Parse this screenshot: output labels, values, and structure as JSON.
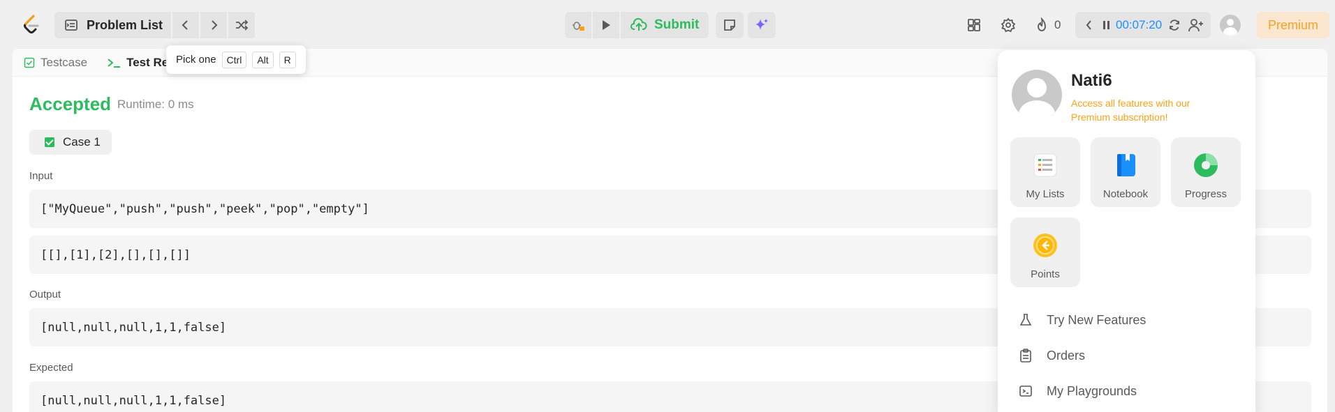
{
  "topbar": {
    "problem_list": "Problem List",
    "submit": "Submit",
    "streak": "0",
    "timer": "00:07:20",
    "premium": "Premium"
  },
  "tabs": [
    {
      "label": "Testcase"
    },
    {
      "label": "Test Resu"
    }
  ],
  "tooltip": {
    "label": "Pick one",
    "keys": [
      "Ctrl",
      "Alt",
      "R"
    ]
  },
  "result": {
    "status": "Accepted",
    "runtime": "Runtime: 0 ms",
    "case": "Case 1",
    "input_label": "Input",
    "input_line1": "[\"MyQueue\",\"push\",\"push\",\"peek\",\"pop\",\"empty\"]",
    "input_line2": "[[],[1],[2],[],[],[]]",
    "output_label": "Output",
    "output": "[null,null,null,1,1,false]",
    "expected_label": "Expected",
    "expected": "[null,null,null,1,1,false]"
  },
  "profile": {
    "username": "Nati6",
    "promo": "Access all features with our Premium subscription!",
    "tiles": [
      {
        "label": "My Lists",
        "icon": "list-icon"
      },
      {
        "label": "Notebook",
        "icon": "notebook-icon"
      },
      {
        "label": "Progress",
        "icon": "progress-icon"
      },
      {
        "label": "Points",
        "icon": "points-icon"
      }
    ],
    "menu": [
      {
        "label": "Try New Features",
        "icon": "flask-icon"
      },
      {
        "label": "Orders",
        "icon": "clipboard-icon"
      },
      {
        "label": "My Playgrounds",
        "icon": "terminal-icon"
      }
    ]
  },
  "colors": {
    "accepted": "#2cbb5d",
    "premium": "#ffa116",
    "timer": "#1a90ff"
  }
}
